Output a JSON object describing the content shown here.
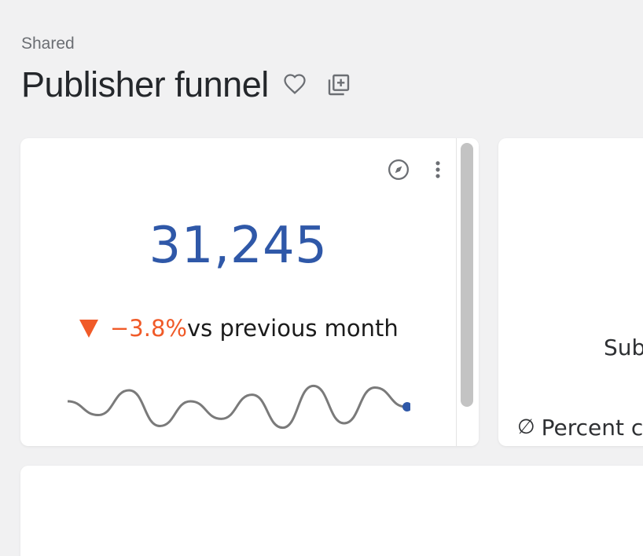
{
  "breadcrumb": "Shared",
  "dashboard_title": "Publisher funnel",
  "icons": {
    "favorite": "heart-outline-icon",
    "copy": "copy-add-icon",
    "explore": "compass-icon",
    "menu": "more-vert-icon",
    "trend": "triangle-down-icon"
  },
  "kpi_card": {
    "value": "31,245",
    "delta": "−3.8%",
    "comparison": "vs previous month",
    "trend_color": "#f05a28",
    "value_color": "#2f58a8",
    "sparkline": [
      0.3,
      0.55,
      0.1,
      0.75,
      0.3,
      0.62,
      0.18,
      0.78,
      0.02,
      0.7,
      0.05,
      0.4
    ]
  },
  "second_card": {
    "label": "Sub",
    "footer_symbol": "∅",
    "footer_text": "Percent c"
  }
}
